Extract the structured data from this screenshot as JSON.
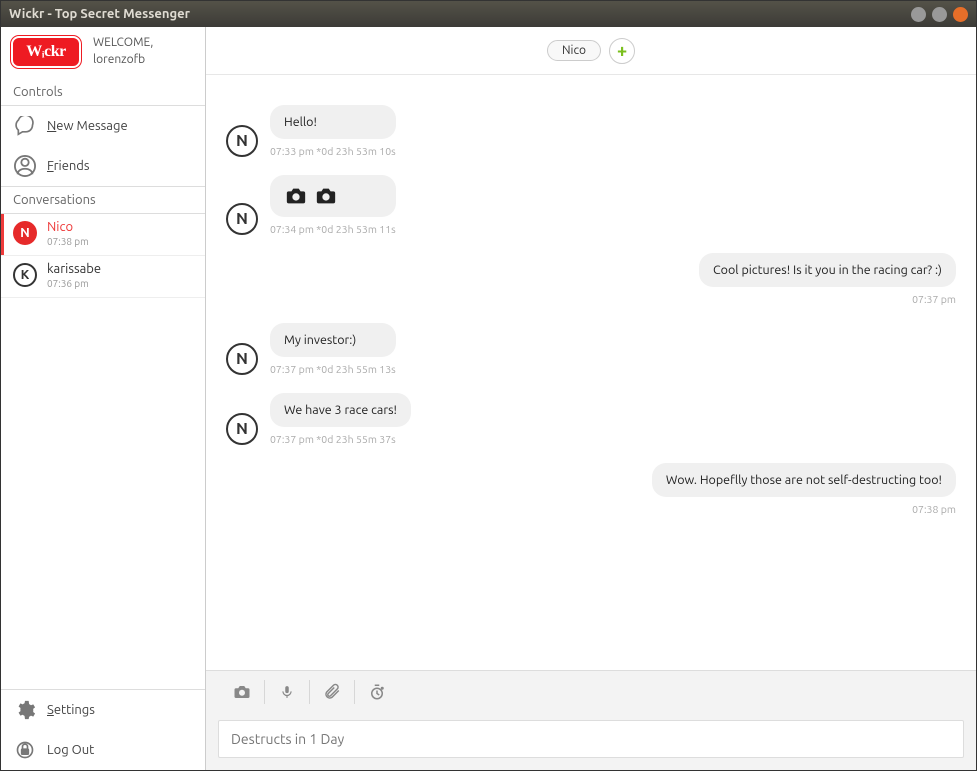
{
  "window": {
    "title": "Wickr - Top Secret Messenger"
  },
  "logo": {
    "text": "Wᵢckr"
  },
  "welcome": {
    "line1": "WELCOME,",
    "line2": "lorenzofb"
  },
  "sidebar": {
    "controls_hdr": "Controls",
    "new_message": "New Message",
    "friends": "Friends",
    "conversations_hdr": "Conversations",
    "conversations": [
      {
        "name": "Nico",
        "time": "07:38 pm",
        "initial": "N",
        "active": true
      },
      {
        "name": "karissabe",
        "time": "07:36 pm",
        "initial": "K",
        "active": false
      }
    ],
    "settings": "Settings",
    "logout": "Log Out"
  },
  "chat": {
    "peer": "Nico",
    "messages": [
      {
        "dir": "in",
        "initial": "N",
        "text": "Hello!",
        "meta": "07:33 pm  *0d 23h 53m 10s"
      },
      {
        "dir": "in",
        "initial": "N",
        "type": "photos",
        "meta": "07:34 pm  *0d 23h 53m 11s"
      },
      {
        "dir": "out",
        "text": "Cool pictures! Is it you in the racing car? :)",
        "meta": "07:37 pm"
      },
      {
        "dir": "in",
        "initial": "N",
        "text": "My investor:)",
        "meta": "07:37 pm  *0d 23h 55m 13s"
      },
      {
        "dir": "in",
        "initial": "N",
        "text": "We have 3 race cars!",
        "meta": "07:37 pm  *0d 23h 55m 37s"
      },
      {
        "dir": "out",
        "text": "Wow. Hopeflly those are not self-destructing too!",
        "meta": "07:38 pm"
      }
    ],
    "composer_placeholder": "Destructs in 1 Day"
  }
}
